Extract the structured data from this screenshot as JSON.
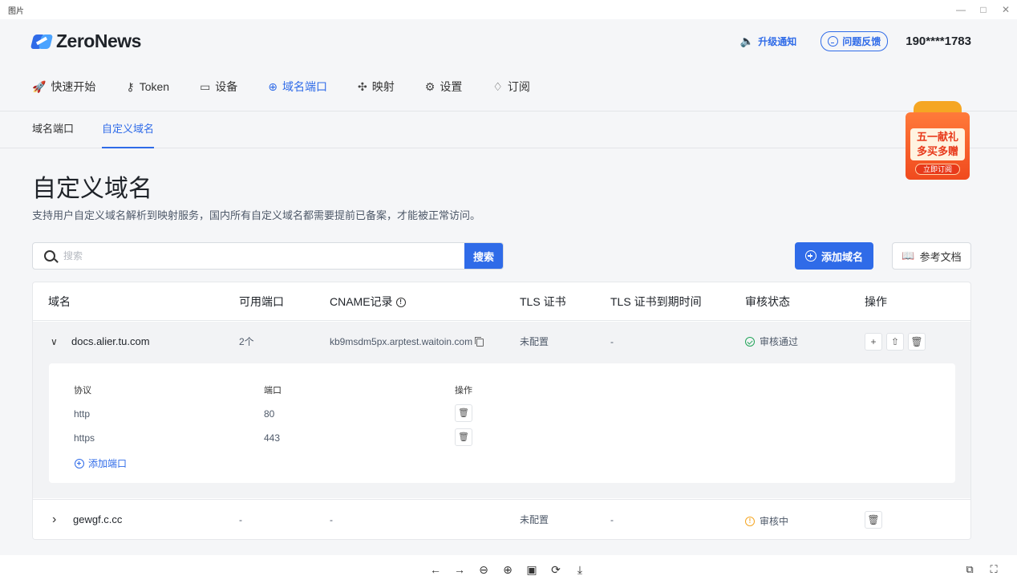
{
  "window": {
    "title": "图片",
    "controls": [
      "—",
      "□",
      "✕"
    ]
  },
  "brand": {
    "name": "ZeroNews"
  },
  "header": {
    "notify_label": "升级通知",
    "feedback_label": "问题反馈",
    "phone": "190****1783"
  },
  "nav": {
    "items": [
      {
        "label": "快速开始",
        "icon": "rocket-icon",
        "glyph": "🚀"
      },
      {
        "label": "Token",
        "icon": "key-icon",
        "glyph": "⚷"
      },
      {
        "label": "设备",
        "icon": "laptop-icon",
        "glyph": "▭"
      },
      {
        "label": "域名端口",
        "icon": "globe-icon",
        "glyph": "⊕"
      },
      {
        "label": "映射",
        "icon": "network-icon",
        "glyph": "✣"
      },
      {
        "label": "设置",
        "icon": "gear-icon",
        "glyph": "⚙"
      },
      {
        "label": "订阅",
        "icon": "diamond-icon",
        "glyph": "♢"
      }
    ],
    "active_index": 3,
    "accent": "#2f6be8"
  },
  "subtabs": {
    "items": [
      "域名端口",
      "自定义域名"
    ],
    "active_index": 1
  },
  "promo": {
    "line1": "五一献礼",
    "line2": "多买多赠",
    "button": "立即订阅"
  },
  "page": {
    "title": "自定义域名",
    "description": "支持用户自定义域名解析到映射服务，国内所有自定义域名都需要提前已备案，才能被正常访问。"
  },
  "search": {
    "placeholder": "搜索",
    "button": "搜索"
  },
  "actions": {
    "add_domain": "添加域名",
    "docs": "参考文档"
  },
  "table": {
    "headers": [
      "域名",
      "可用端口",
      "CNAME记录",
      "TLS 证书",
      "TLS 证书到期时间",
      "审核状态",
      "操作"
    ],
    "cname_info_glyph": "!",
    "rows": [
      {
        "expanded": true,
        "chevron": "∨",
        "domain": "docs.alier.tu.com",
        "ports": "2个",
        "cname": "kb9msdm5px.arptest.waitoin.com",
        "tls": "未配置",
        "tls_expiry": "-",
        "status": "审核通过",
        "status_type": "approved",
        "status_color": "#23a55a",
        "ops": [
          "+",
          "⇧",
          "🗑"
        ],
        "sub": {
          "headers": [
            "协议",
            "端口",
            "操作"
          ],
          "rows": [
            {
              "protocol": "http",
              "port": "80"
            },
            {
              "protocol": "https",
              "port": "443"
            }
          ],
          "add_label": "添加端口"
        }
      },
      {
        "expanded": false,
        "chevron": "›",
        "domain": "gewgf.c.cc",
        "ports": "-",
        "cname": "-",
        "tls": "未配置",
        "tls_expiry": "-",
        "status": "审核中",
        "status_type": "pending",
        "status_color": "#f5a623",
        "ops": [
          "🗑"
        ]
      }
    ]
  },
  "viewer_toolbar": {
    "center": [
      "←",
      "→",
      "⊖",
      "⊕",
      "▣",
      "⟳",
      "⤓"
    ],
    "right": [
      "⧉",
      "⛶"
    ]
  }
}
